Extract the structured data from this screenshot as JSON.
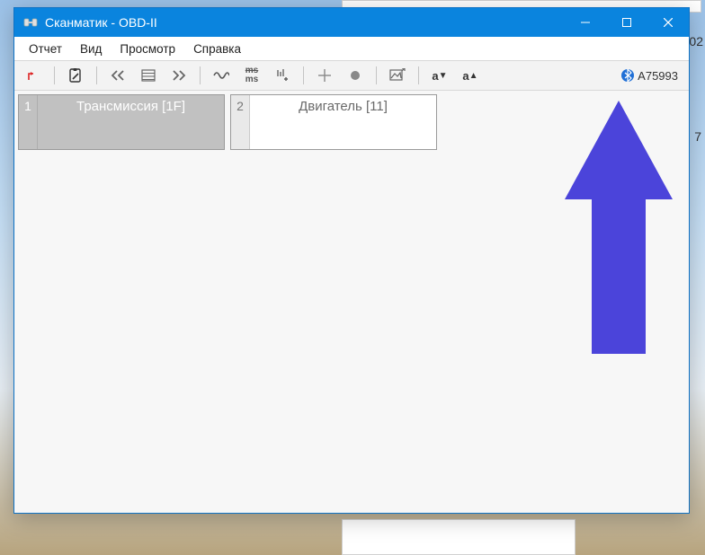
{
  "window": {
    "title": "Сканматик - OBD-II"
  },
  "menu": {
    "report": "Отчет",
    "view": "Вид",
    "browse": "Просмотр",
    "help": "Справка"
  },
  "toolbar": {
    "ms_label": "ms"
  },
  "bluetooth": {
    "code": "A75993"
  },
  "cards": [
    {
      "index": "1",
      "label": "Трансмиссия [1F]",
      "selected": true
    },
    {
      "index": "2",
      "label": "Двигатель [11]",
      "selected": false
    }
  ],
  "bg": {
    "frag1": "02",
    "frag2": "7"
  }
}
